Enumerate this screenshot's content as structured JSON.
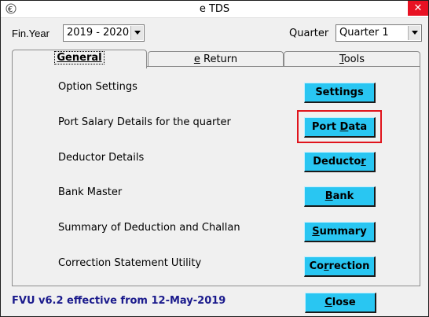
{
  "window": {
    "title": "e TDS",
    "close_glyph": "✕",
    "app_icon": "etds-app-icon"
  },
  "header": {
    "fin_year_label": "Fin.Year",
    "fin_year_value": "2019 - 2020",
    "quarter_label": "Quarter",
    "quarter_value": "Quarter 1"
  },
  "tabs": [
    {
      "label": "General",
      "hotkey_prefix": "",
      "hotkey": "G",
      "rest": "eneral",
      "active": true
    },
    {
      "label": "e Return",
      "hotkey_prefix": "",
      "hotkey": "e",
      "rest": " Return",
      "active": false
    },
    {
      "label": "Tools",
      "hotkey_prefix": "",
      "hotkey": "T",
      "rest": "ools",
      "active": false
    }
  ],
  "rows": [
    {
      "label": "Option Settings",
      "button": {
        "before": "Settings",
        "hot": "",
        "after": ""
      }
    },
    {
      "label": "Port Salary Details for the quarter",
      "button": {
        "before": "Port ",
        "hot": "D",
        "after": "ata"
      }
    },
    {
      "label": "Deductor Details",
      "button": {
        "before": "Deducto",
        "hot": "r",
        "after": ""
      }
    },
    {
      "label": "Bank Master",
      "button": {
        "before": "",
        "hot": "B",
        "after": "ank"
      }
    },
    {
      "label": "Summary of Deduction and Challan",
      "button": {
        "before": "",
        "hot": "S",
        "after": "ummary"
      }
    },
    {
      "label": "Correction Statement Utility",
      "button": {
        "before": "Co",
        "hot": "r",
        "after": "rection"
      }
    }
  ],
  "footer": {
    "version_text": "FVU v6.2 effective from 12-May-2019",
    "close_before": "",
    "close_hot": "C",
    "close_after": "lose"
  },
  "colors": {
    "button_bg": "#29c6f2",
    "highlight_border": "#e0141c",
    "footer_text": "#1a1a8c",
    "titlebar_close": "#e81123"
  }
}
